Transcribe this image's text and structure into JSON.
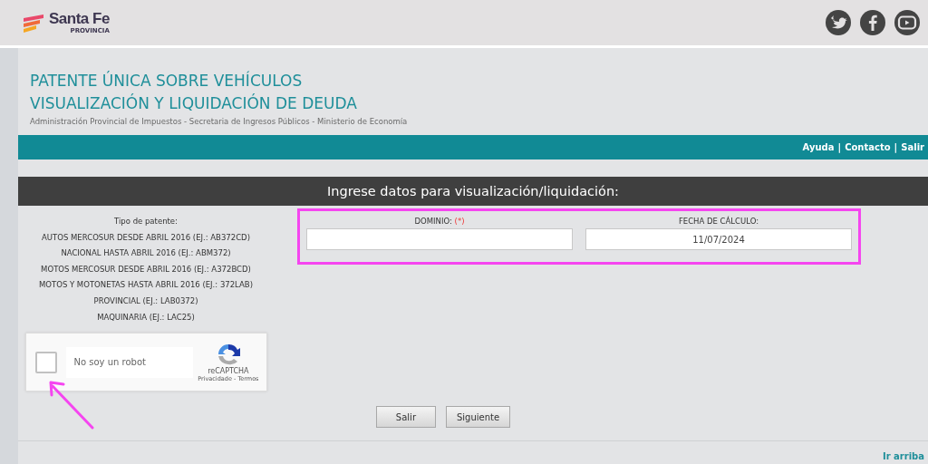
{
  "header": {
    "logo_text": "Santa Fe",
    "logo_subtext": "PROVINCIA"
  },
  "title_lines": [
    "PATENTE ÚNICA SOBRE VEHÍCULOS",
    "VISUALIZACIÓN Y LIQUIDACIÓN DE DEUDA"
  ],
  "subtitle": "Administración Provincial de Impuestos - Secretaria de Ingresos Públicos - Ministerio de Economía",
  "nav_links": [
    "Ayuda",
    "Contacto",
    "Salir"
  ],
  "nav_separator": "|",
  "form_title": "Ingrese datos para visualización/liquidación:",
  "plate_types": {
    "heading": "Tipo de patente:",
    "items": [
      "AUTOS MERCOSUR DESDE ABRIL 2016 (EJ.: AB372CD)",
      "NACIONAL HASTA ABRIL 2016 (EJ.: ABM372)",
      "MOTOS MERCOSUR DESDE ABRIL 2016 (EJ.: A372BCD)",
      "MOTOS Y MOTONETAS HASTA ABRIL 2016 (EJ.: 372LAB)",
      "PROVINCIAL (EJ.: LAB0372)",
      "MAQUINARIA (EJ.: LAC25)"
    ]
  },
  "fields": [
    {
      "label": "DOMINIO:",
      "required_mark": "(*)"
    },
    {
      "label": "FECHA DE CÁLCULO:",
      "value": "11/07/2024"
    }
  ],
  "captcha": {
    "label": "No soy un robot",
    "checked": false,
    "brand": "reCAPTCHA",
    "links": [
      "Privacidade",
      "Termos"
    ],
    "link_separator": "-"
  },
  "buttons": [
    "Salir",
    "Siguiente"
  ],
  "footer_link": "Ir arriba"
}
